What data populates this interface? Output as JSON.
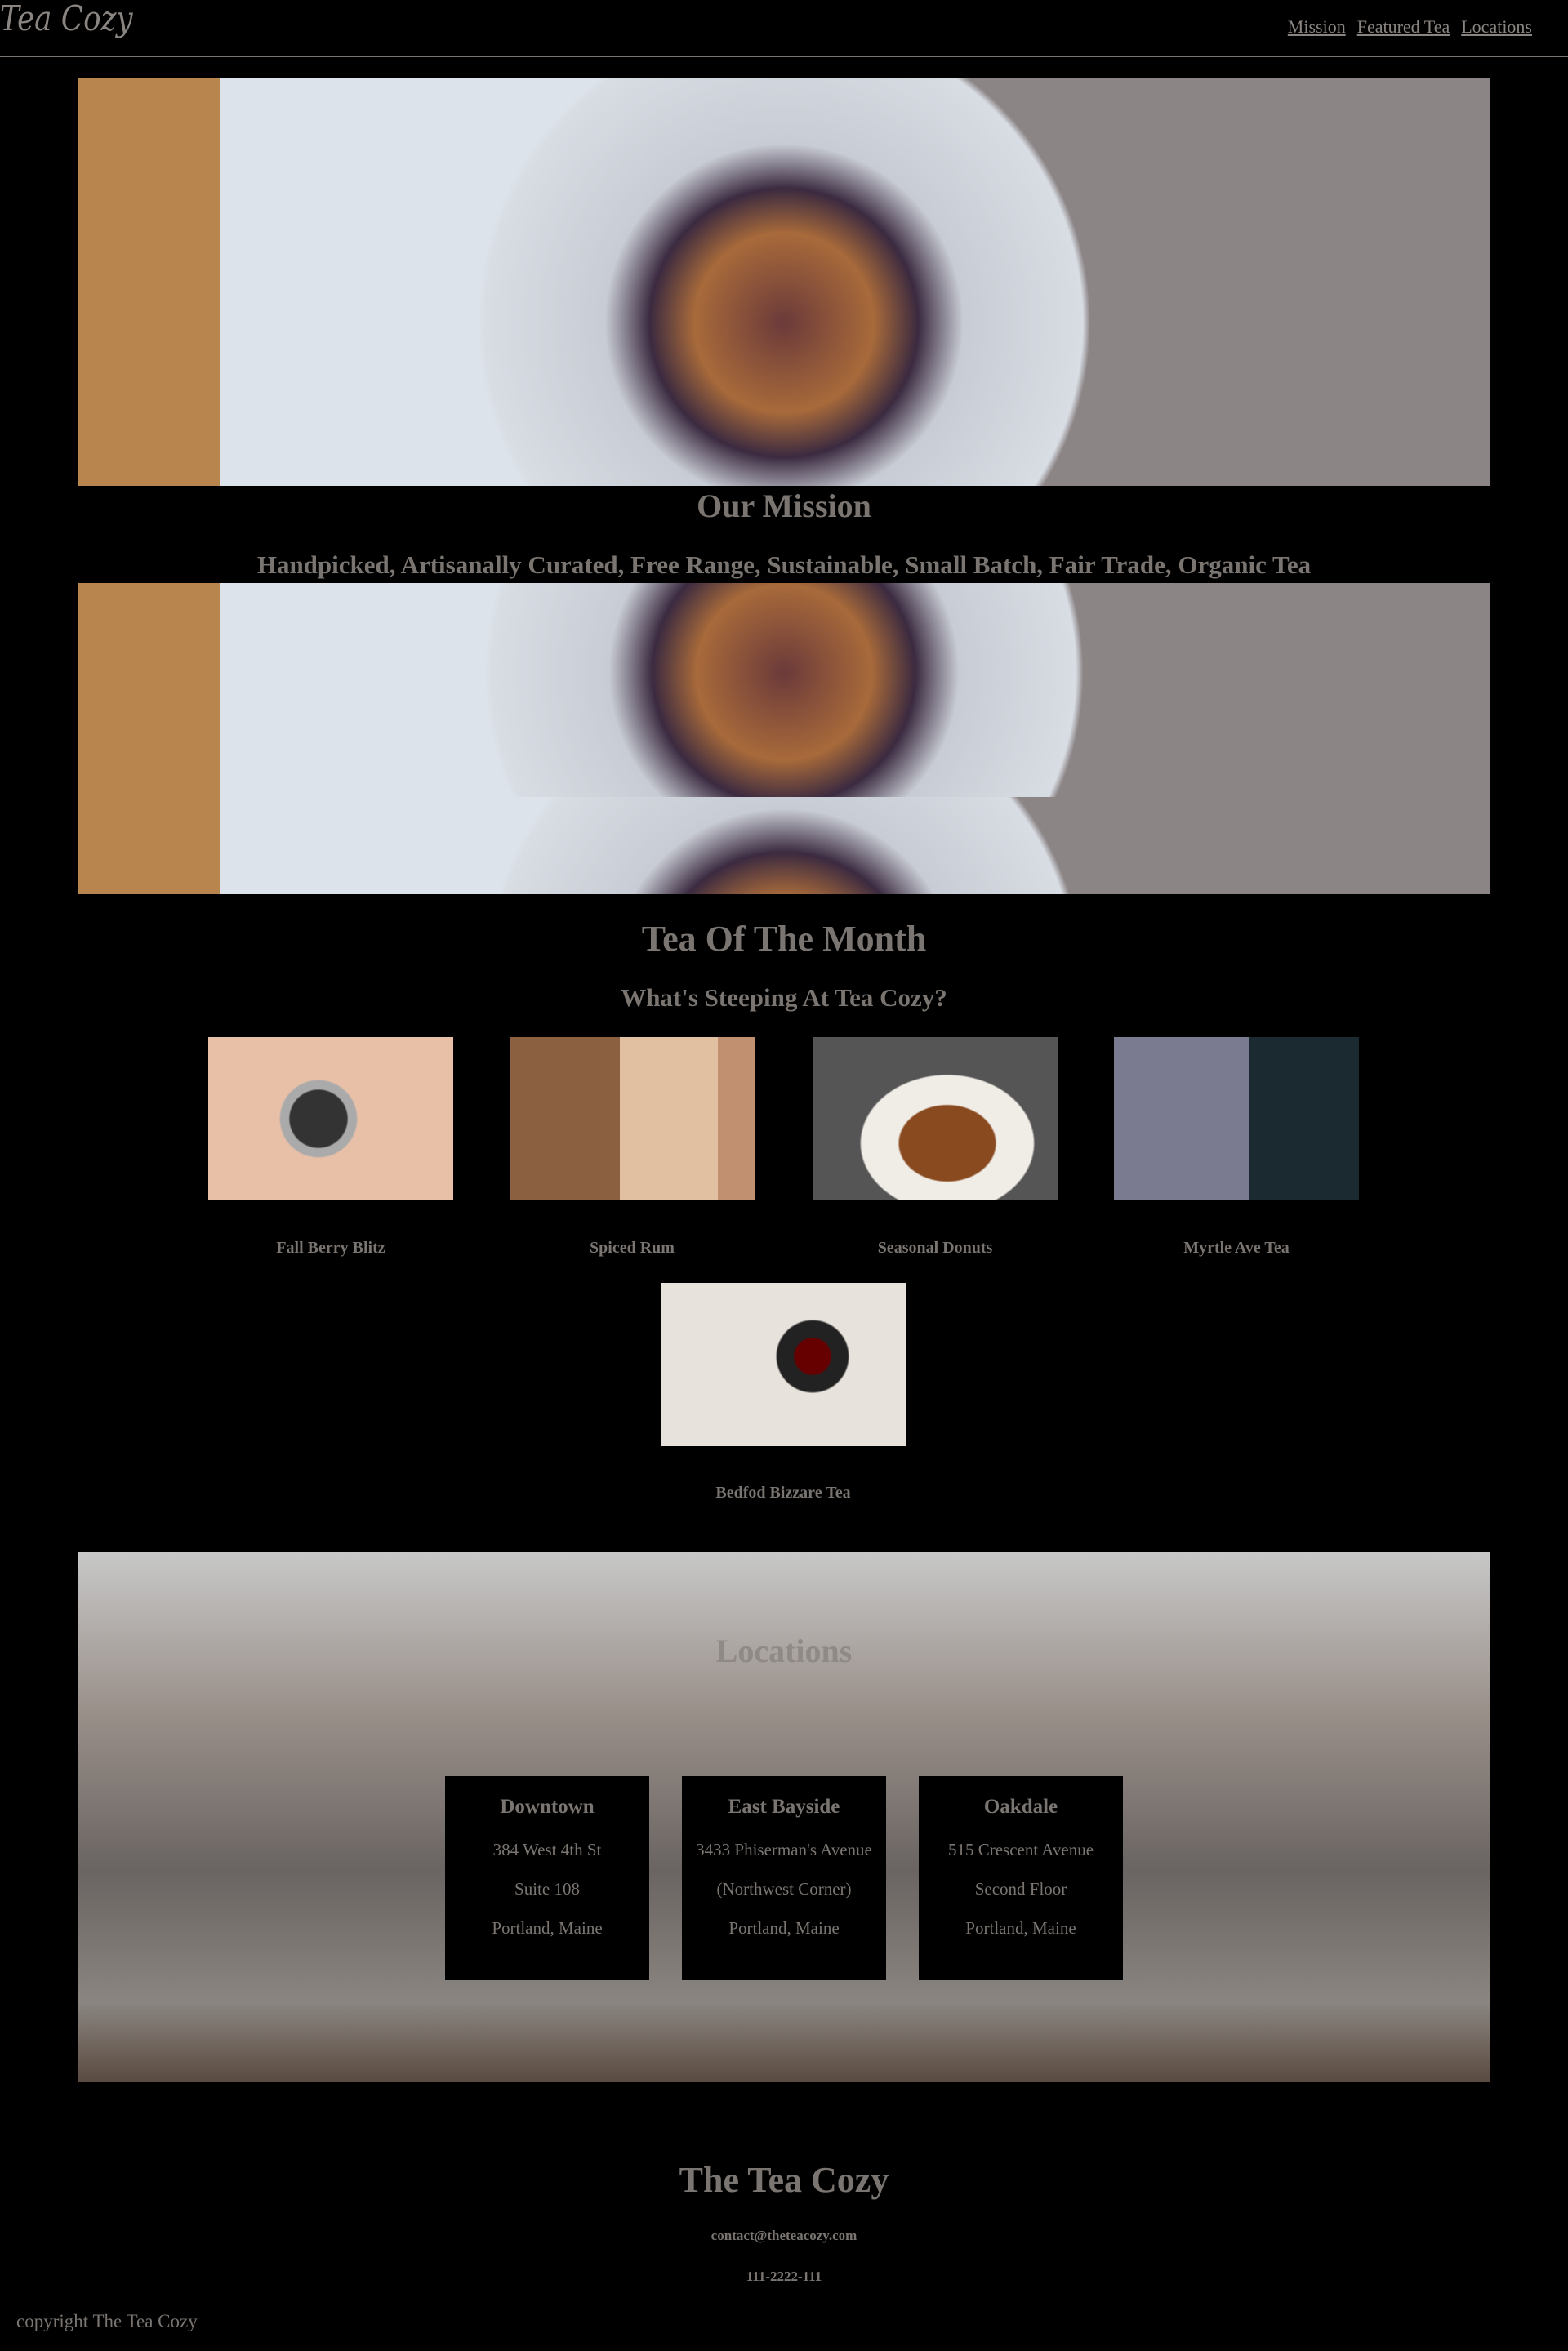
{
  "header": {
    "logo": "Tea Cozy",
    "nav": [
      "Mission",
      "Featured Tea",
      "Locations"
    ]
  },
  "mission": {
    "title": "Our Mission",
    "subtitle": "Handpicked, Artisanally Curated, Free Range, Sustainable, Small Batch, Fair Trade, Organic Tea"
  },
  "featured": {
    "title": "Tea Of The Month",
    "subtitle": "What's Steeping At Tea Cozy?",
    "items": [
      {
        "name": "Fall Berry Blitz"
      },
      {
        "name": "Spiced Rum"
      },
      {
        "name": "Seasonal Donuts"
      },
      {
        "name": "Myrtle Ave Tea"
      },
      {
        "name": "Bedfod Bizzare Tea"
      }
    ]
  },
  "locations": {
    "title": "Locations",
    "items": [
      {
        "name": "Downtown",
        "lines": [
          "384 West 4th St",
          "Suite 108",
          "Portland, Maine"
        ]
      },
      {
        "name": "East Bayside",
        "lines": [
          "3433 Phiserman's Avenue",
          "(Northwest Corner)",
          "Portland, Maine"
        ]
      },
      {
        "name": "Oakdale",
        "lines": [
          "515 Crescent Avenue",
          "Second Floor",
          "Portland, Maine"
        ]
      }
    ]
  },
  "footer": {
    "title": "The Tea Cozy",
    "email": "contact@theteacozy.com",
    "phone": "111-2222-111",
    "copyright": "copyright The Tea Cozy"
  },
  "colors": {
    "background": "#000000",
    "text": "#7a7570"
  }
}
